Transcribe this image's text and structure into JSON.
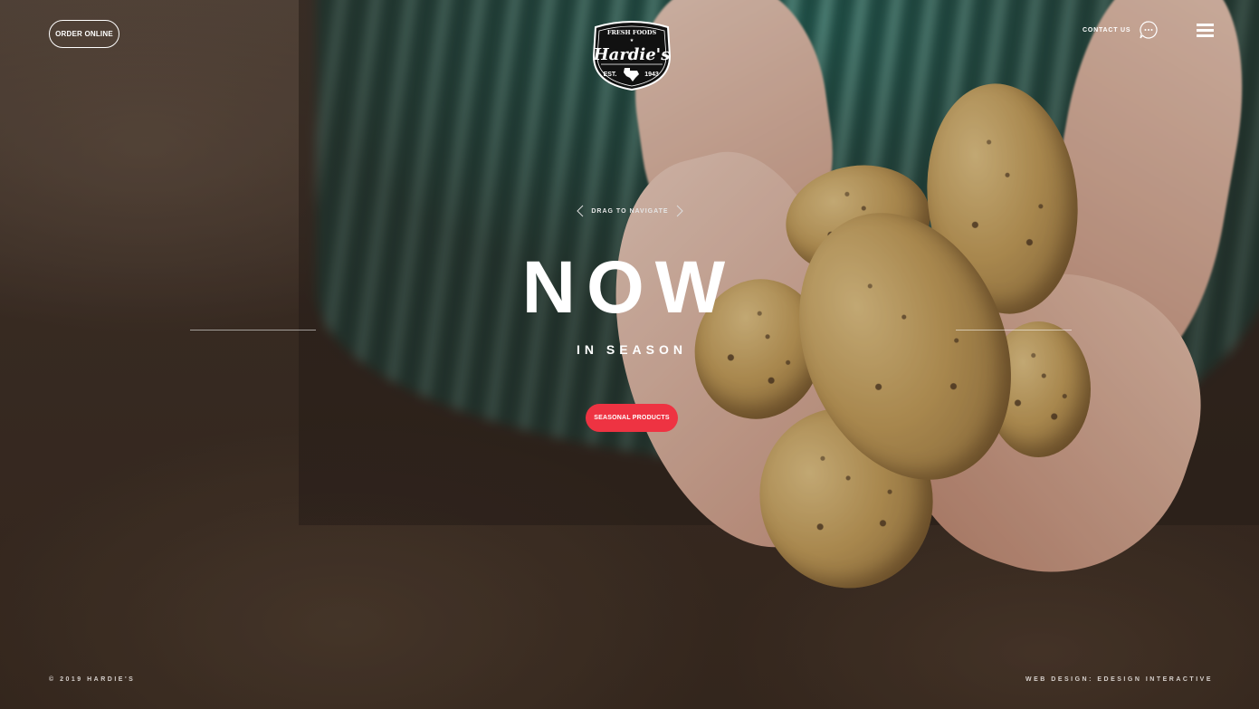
{
  "header": {
    "order_button_label": "ORDER ONLINE",
    "contact_label": "CONTACT US",
    "logo": {
      "top_text": "FRESH FOODS",
      "name": "Hardie's",
      "est_label": "EST.",
      "est_year": "1943"
    }
  },
  "hero": {
    "drag_label": "DRAG TO NAVIGATE",
    "headline": "NOW",
    "subheadline": "IN SEASON",
    "cta_label": "SEASONAL PRODUCTS"
  },
  "footer": {
    "copyright": "© 2019 HARDIE'S",
    "credit": "WEB DESIGN: EDESIGN INTERACTIVE"
  },
  "colors": {
    "accent": "#ee3342",
    "text": "#ffffff",
    "logo_bg": "#111111"
  },
  "icons": [
    "chat-icon",
    "menu-icon",
    "chevron-left-icon",
    "chevron-right-icon",
    "texas-star-icon"
  ]
}
